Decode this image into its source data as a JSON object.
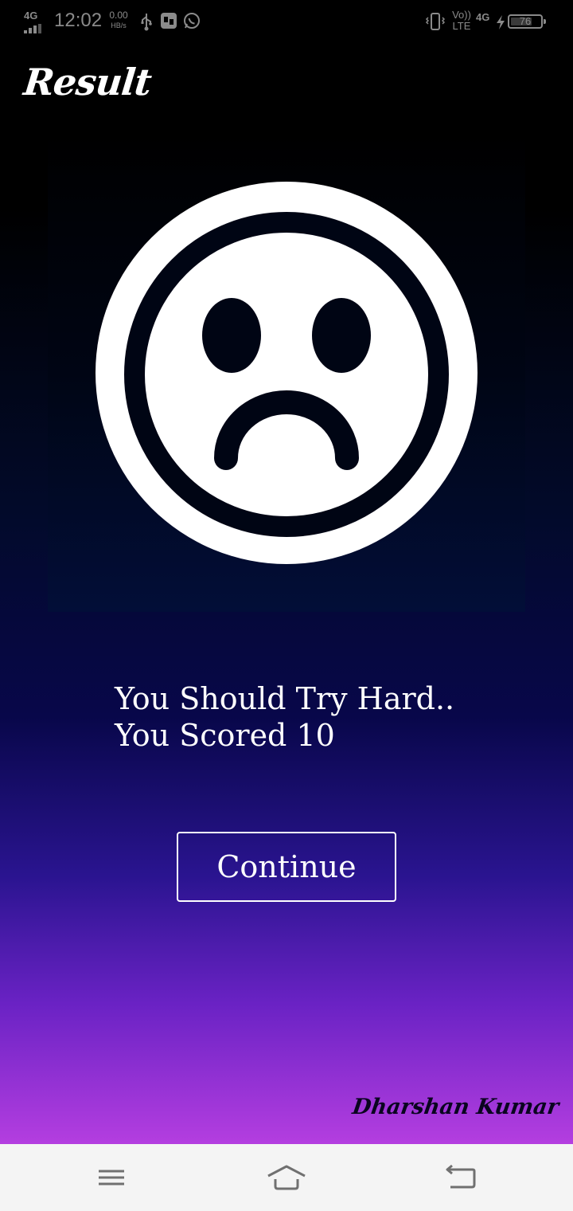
{
  "status_bar": {
    "network": "4G",
    "time": "12:02",
    "speed_value": "0.00",
    "speed_unit": "HB/s",
    "volte_top": "Vo))",
    "volte_bottom": "LTE",
    "network_right": "4G",
    "battery": "76",
    "battery_level": 0.76,
    "icons": [
      "usb-icon",
      "sim-toolkit-icon",
      "whatsapp-icon",
      "vibrate-icon",
      "charging-icon"
    ]
  },
  "header": {
    "title": "Result"
  },
  "result_image": {
    "icon": "sad-face-icon"
  },
  "message": {
    "line1": "You Should Try Hard..",
    "line2": "You Scored 10",
    "score": 10
  },
  "actions": {
    "continue_label": "Continue"
  },
  "footer": {
    "credit": "Dharshan Kumar"
  },
  "nav_bar": {
    "icons": [
      "menu-icon",
      "home-icon",
      "back-icon"
    ]
  },
  "colors": {
    "text": "#ffffff",
    "gradient_top": "#000000",
    "gradient_bottom": "#b43ee0",
    "nav_background": "#f4f4f4"
  }
}
